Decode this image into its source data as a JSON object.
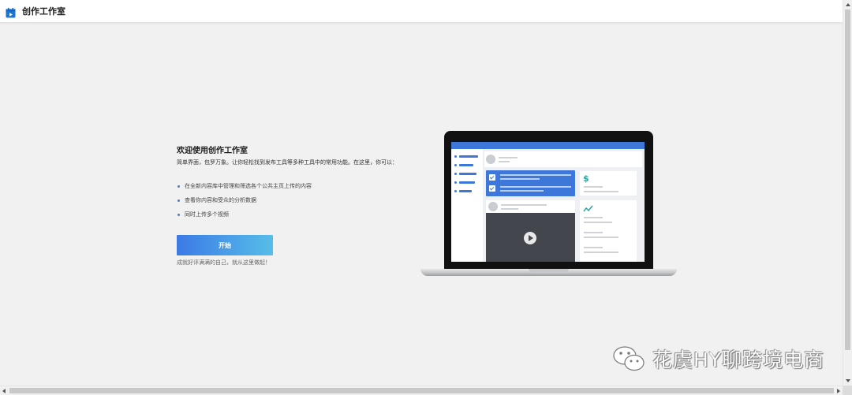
{
  "header": {
    "app_title": "创作工作室",
    "logo_icon": "studio-logo-icon",
    "accent_color": "#e53935"
  },
  "welcome": {
    "title": "欢迎使用创作工作室",
    "description": "简单界面，包罗万象。让你轻松找到发布工具等多种工具中的常用功能。在这里，你可以：",
    "features": [
      "在全新内容库中管理和筛选各个公共主页上传的内容",
      "查看你内容和受众的分析数据",
      "同时上传多个视频"
    ],
    "start_button_label": "开始",
    "tagline": "成就好评满满的自己，就从这里做起！",
    "button_gradient": [
      "#3b7ae6",
      "#57bde9"
    ]
  },
  "illustration": {
    "icon": "laptop-illustration",
    "screen_accent": "#3d77d9"
  },
  "watermark": {
    "icon": "wechat-icon",
    "text": "花虞HY聊跨境电商"
  }
}
